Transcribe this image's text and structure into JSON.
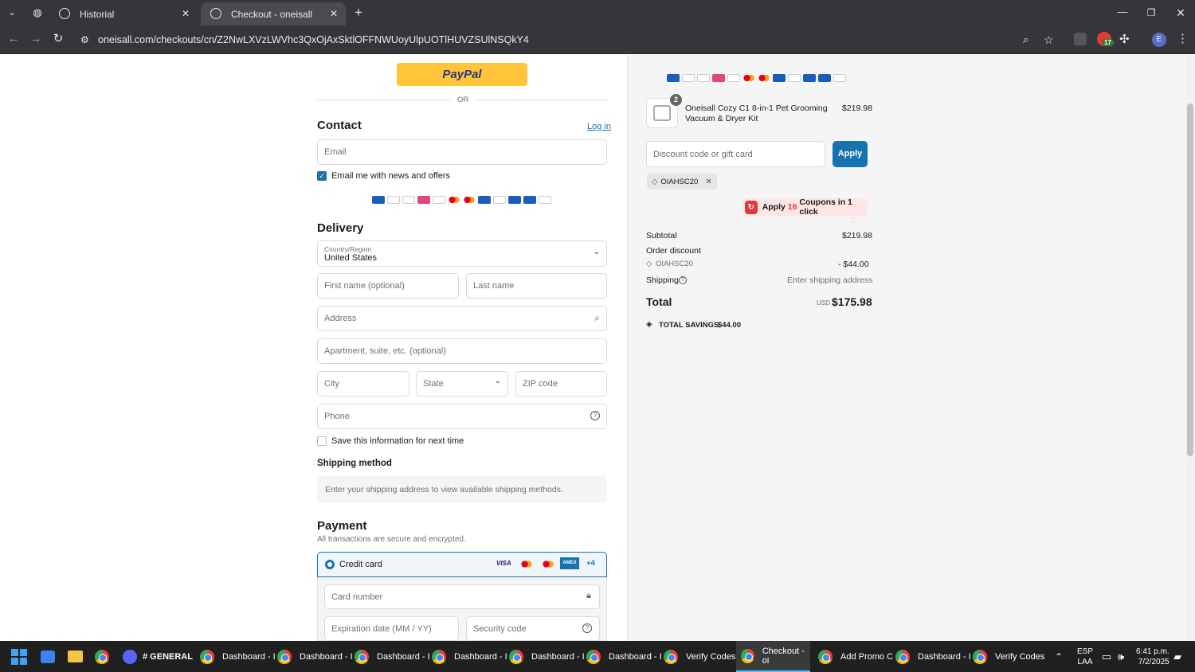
{
  "browser": {
    "tabs": [
      {
        "title": "Historial"
      },
      {
        "title": "Checkout - oneisall"
      }
    ],
    "url": "oneisall.com/checkouts/cn/Z2NwLXVzLWVhc3QxOjAxSktlOFFNWUoyUlpUOTlHUVZSUlNSQkY4",
    "extension_badge": "17",
    "profile_initial": "E"
  },
  "left": {
    "paypal_label": "PayPal",
    "or_label": "OR",
    "contact": {
      "title": "Contact",
      "login_link": "Log in",
      "email_placeholder": "Email",
      "newsletter_label": "Email me with news and offers"
    },
    "delivery": {
      "title": "Delivery",
      "country_label": "Country/Region",
      "country_value": "United States",
      "first_name_placeholder": "First name (optional)",
      "last_name_placeholder": "Last name",
      "address_placeholder": "Address",
      "apartment_placeholder": "Apartment, suite, etc. (optional)",
      "city_placeholder": "City",
      "state_placeholder": "State",
      "zip_placeholder": "ZIP code",
      "phone_placeholder": "Phone",
      "save_info_label": "Save this information for next time"
    },
    "shipping": {
      "title": "Shipping method",
      "notice": "Enter your shipping address to view available shipping methods."
    },
    "payment": {
      "title": "Payment",
      "subtitle": "All transactions are secure and encrypted.",
      "method_label": "Credit card",
      "more_cards": "+4",
      "card_brands": [
        "VISA",
        "AMEX"
      ],
      "card_number_placeholder": "Card number",
      "expiry_placeholder": "Expiration date (MM / YY)",
      "security_placeholder": "Security code"
    }
  },
  "right": {
    "product": {
      "quantity": "2",
      "name_line1": "Oneisall Cozy C1 8-in-1 Pet Grooming",
      "name_line2": "Vacuum & Dryer Kit",
      "price": "$219.98"
    },
    "discount_placeholder": "Discount code or gift card",
    "apply_button": "Apply",
    "applied_code": "OIAHSC20",
    "coupon_extension": {
      "prefix": "Apply",
      "count": "16",
      "suffix": "Coupons in 1 click"
    },
    "summary": {
      "subtotal_label": "Subtotal",
      "subtotal_value": "$219.98",
      "order_discount_label": "Order discount",
      "discount_code": "OIAHSC20",
      "discount_value": "- $44.00",
      "shipping_label": "Shipping",
      "shipping_value": "Enter shipping address",
      "total_label": "Total",
      "currency": "USD",
      "total_value": "$175.98",
      "savings_label": "TOTAL SAVINGS",
      "savings_value": "$44.00"
    }
  },
  "taskbar": {
    "items": [
      {
        "label": "# GENERAL"
      },
      {
        "label": "Dashboard - I"
      },
      {
        "label": "Dashboard - I"
      },
      {
        "label": "Dashboard - I"
      },
      {
        "label": "Dashboard - I"
      },
      {
        "label": "Dashboard - I"
      },
      {
        "label": "Dashboard - I"
      },
      {
        "label": "Verify Codes"
      },
      {
        "label": "Checkout - oi"
      },
      {
        "label": "Add Promo C"
      },
      {
        "label": "Dashboard - I"
      },
      {
        "label": "Verify Codes"
      }
    ],
    "lang_top": "ESP",
    "lang_bottom": "LAA",
    "time": "6:41 p.m.",
    "date": "7/2/2025"
  },
  "colors": {
    "accent": "#1773b0",
    "paypal": "#ffc439",
    "coupon_red": "#e53935"
  }
}
